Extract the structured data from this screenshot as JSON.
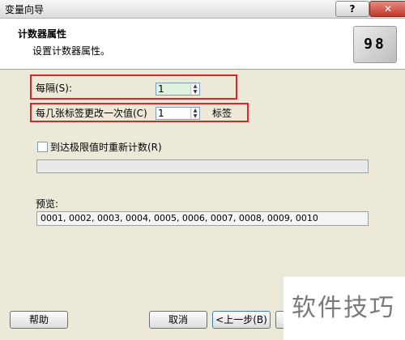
{
  "window": {
    "title": "变量向导",
    "help_glyph": "?",
    "close_glyph": "✕"
  },
  "header": {
    "title": "计数器属性",
    "subtitle": "设置计数器属性。",
    "icon_name": "counter-icon",
    "icon_text": "98"
  },
  "form": {
    "interval": {
      "label": "每隔(S):",
      "value": "1"
    },
    "change_every": {
      "label": "每几张标签更改一次值(C)",
      "value": "1",
      "suffix": "标签"
    },
    "reset": {
      "label": "到达极限值时重新计数(R)",
      "checked": false
    },
    "preview": {
      "label": "预览:",
      "value": "0001, 0002, 0003, 0004, 0005, 0006, 0007, 0008, 0009, 0010"
    }
  },
  "buttons": {
    "help": "帮助",
    "cancel": "取消",
    "prev": "<上一步(B)",
    "next": ""
  },
  "watermark": "软件技巧",
  "colors": {
    "highlight_border": "#d9262b",
    "active_input_bg": "#dff3df"
  }
}
